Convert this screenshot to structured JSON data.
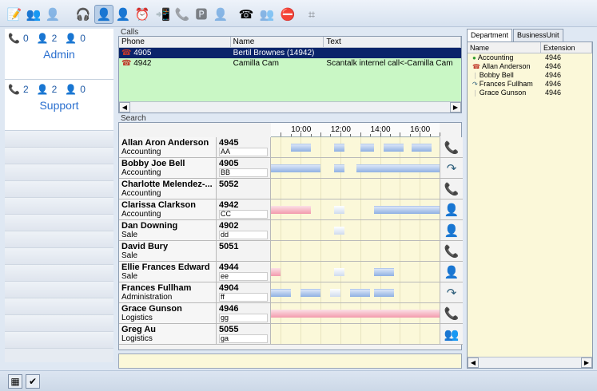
{
  "toolbar": {
    "buttons": [
      {
        "name": "edit-profile-icon",
        "glyph": "📝",
        "active": false,
        "disabled": false
      },
      {
        "name": "users-group-icon",
        "glyph": "👥",
        "active": false,
        "disabled": false
      },
      {
        "name": "user-grey-icon",
        "glyph": "👤",
        "active": false,
        "disabled": true
      },
      {
        "name": "user-headset-icon",
        "glyph": "🎧",
        "active": false,
        "disabled": false
      },
      {
        "name": "user-available-icon",
        "glyph": "👤",
        "active": true,
        "disabled": false
      },
      {
        "name": "user-busy-icon",
        "glyph": "👤",
        "active": false,
        "disabled": false
      },
      {
        "name": "user-clock-icon",
        "glyph": "⏰",
        "active": false,
        "disabled": false
      },
      {
        "name": "transfer-call-icon",
        "glyph": "📲",
        "active": false,
        "disabled": false
      },
      {
        "name": "call-back-icon",
        "glyph": "📞",
        "active": false,
        "disabled": true
      },
      {
        "name": "park-icon",
        "glyph": "🅿",
        "active": false,
        "disabled": true
      },
      {
        "name": "user-forward-icon",
        "glyph": "👤",
        "active": false,
        "disabled": true
      },
      {
        "name": "hang-up-icon",
        "glyph": "☎",
        "active": false,
        "disabled": false
      },
      {
        "name": "conference-icon",
        "glyph": "👥",
        "active": false,
        "disabled": true
      },
      {
        "name": "stop-icon",
        "glyph": "⛔",
        "active": false,
        "disabled": false
      },
      {
        "name": "keypad-icon",
        "glyph": "⌗",
        "active": false,
        "disabled": true
      }
    ]
  },
  "groups": [
    {
      "name": "Admin",
      "calls": "0",
      "agents_busy": "2",
      "agents_free": "0"
    },
    {
      "name": "Support",
      "calls": "2",
      "agents_busy": "2",
      "agents_free": "0"
    }
  ],
  "calls": {
    "label": "Calls",
    "columns": [
      "Phone",
      "Name",
      "Text"
    ],
    "rows": [
      {
        "phone": "4905",
        "name": "Bertil Brownes (14942)",
        "text": "",
        "selected": true
      },
      {
        "phone": "4942",
        "name": "Camilla Cam",
        "text": "Scantalk internel call<-Camilla Cam",
        "selected": false
      }
    ]
  },
  "search": {
    "label": "Search",
    "time_labels": [
      "10:00",
      "12:00",
      "14:00",
      "16:00"
    ],
    "timeline_start_hour": 8.5,
    "timeline_end_hour": 17.0,
    "rows": [
      {
        "name": "Allan Aron Anderson",
        "dept": "Accounting",
        "ext": "4945",
        "initials": "AA",
        "status_icon": "phone-ringing-icon",
        "status_glyph": "📞",
        "status_color": "#c0392b",
        "bars": [
          {
            "start": 9.5,
            "end": 10.5,
            "kind": "blue"
          },
          {
            "start": 11.7,
            "end": 12.2,
            "kind": "blue"
          },
          {
            "start": 13.0,
            "end": 13.7,
            "kind": "blue"
          },
          {
            "start": 14.2,
            "end": 15.2,
            "kind": "blue"
          },
          {
            "start": 15.6,
            "end": 16.6,
            "kind": "blue"
          }
        ]
      },
      {
        "name": "Bobby Joe Bell",
        "dept": "Accounting",
        "ext": "4905",
        "initials": "BB",
        "status_icon": "call-forward-icon",
        "status_glyph": "↷",
        "status_color": "#2c5d7a",
        "bars": [
          {
            "start": 8.5,
            "end": 11.0,
            "kind": "blue"
          },
          {
            "start": 11.7,
            "end": 12.2,
            "kind": "blue"
          },
          {
            "start": 12.8,
            "end": 17.0,
            "kind": "blue"
          }
        ]
      },
      {
        "name": "Charlotte Melendez-...",
        "dept": "Accounting",
        "ext": "5052",
        "initials": "",
        "status_icon": "phone-idle-icon",
        "status_glyph": "📞",
        "status_color": "#b3b3b3",
        "bars": []
      },
      {
        "name": "Clarissa Clarkson",
        "dept": "Accounting",
        "ext": "4942",
        "initials": "CC",
        "status_icon": "user-available-icon",
        "status_glyph": "👤",
        "status_color": "#2e9b2e",
        "bars": [
          {
            "start": 8.5,
            "end": 10.5,
            "kind": "pink"
          },
          {
            "start": 11.7,
            "end": 12.2,
            "kind": "pale"
          },
          {
            "start": 13.7,
            "end": 17.0,
            "kind": "blue"
          }
        ]
      },
      {
        "name": "Dan Downing",
        "dept": "Sale",
        "ext": "4902",
        "initials": "dd",
        "status_icon": "user-available-icon",
        "status_glyph": "👤",
        "status_color": "#2e9b2e",
        "bars": [
          {
            "start": 11.7,
            "end": 12.2,
            "kind": "pale"
          }
        ]
      },
      {
        "name": "David Bury",
        "dept": "Sale",
        "ext": "5051",
        "initials": "",
        "status_icon": "phone-idle-icon",
        "status_glyph": "📞",
        "status_color": "#b3b3b3",
        "bars": []
      },
      {
        "name": "Ellie Frances Edward",
        "dept": "Sale",
        "ext": "4944",
        "initials": "ee",
        "status_icon": "user-available-icon",
        "status_glyph": "👤",
        "status_color": "#2e9b2e",
        "bars": [
          {
            "start": 8.5,
            "end": 9.0,
            "kind": "pink"
          },
          {
            "start": 11.7,
            "end": 12.2,
            "kind": "pale"
          },
          {
            "start": 13.7,
            "end": 14.7,
            "kind": "blue"
          }
        ]
      },
      {
        "name": "Frances Fullham",
        "dept": "Administration",
        "ext": "4904",
        "initials": "ff",
        "status_icon": "call-forward-icon",
        "status_glyph": "↷",
        "status_color": "#2c5d7a",
        "bars": [
          {
            "start": 8.5,
            "end": 9.5,
            "kind": "blue"
          },
          {
            "start": 10.0,
            "end": 11.0,
            "kind": "blue"
          },
          {
            "start": 11.5,
            "end": 12.0,
            "kind": "pale"
          },
          {
            "start": 12.5,
            "end": 13.5,
            "kind": "blue"
          },
          {
            "start": 13.7,
            "end": 14.7,
            "kind": "blue"
          }
        ]
      },
      {
        "name": "Grace Gunson",
        "dept": "Logistics",
        "ext": "4946",
        "initials": "gg",
        "status_icon": "phone-idle-icon",
        "status_glyph": "📞",
        "status_color": "#b3b3b3",
        "bars": [
          {
            "start": 8.5,
            "end": 17.0,
            "kind": "pink"
          }
        ]
      },
      {
        "name": "Greg Au",
        "dept": "Logistics",
        "ext": "5055",
        "initials": "ga",
        "status_icon": "group-icon",
        "status_glyph": "👥",
        "status_color": "#5a7f6a",
        "bars": []
      }
    ]
  },
  "right": {
    "tabs": [
      "Department",
      "BusinessUnit"
    ],
    "active_tab": 0,
    "columns": [
      "Name",
      "Extension"
    ],
    "rows": [
      {
        "name": "Accounting",
        "ext": "4946",
        "icon": "user-available-icon",
        "glyph": "●",
        "color": "#2e9b2e"
      },
      {
        "name": "Allan Anderson",
        "ext": "4946",
        "icon": "phone-ringing-icon",
        "glyph": "☎",
        "color": "#c0392b"
      },
      {
        "name": "Bobby Bell",
        "ext": "4946",
        "icon": "phone-idle-icon",
        "glyph": "❘",
        "color": "#b3b3b3"
      },
      {
        "name": "Frances Fullham",
        "ext": "4946",
        "icon": "call-forward-icon",
        "glyph": "↷",
        "color": "#2c5d7a"
      },
      {
        "name": "Grace Gunson",
        "ext": "4946",
        "icon": "phone-idle-icon",
        "glyph": "❘",
        "color": "#b3b3b3"
      }
    ]
  },
  "statusbar": {
    "buttons": [
      {
        "name": "network-icon",
        "glyph": "▦"
      },
      {
        "name": "check-icon",
        "glyph": "✔"
      }
    ]
  }
}
